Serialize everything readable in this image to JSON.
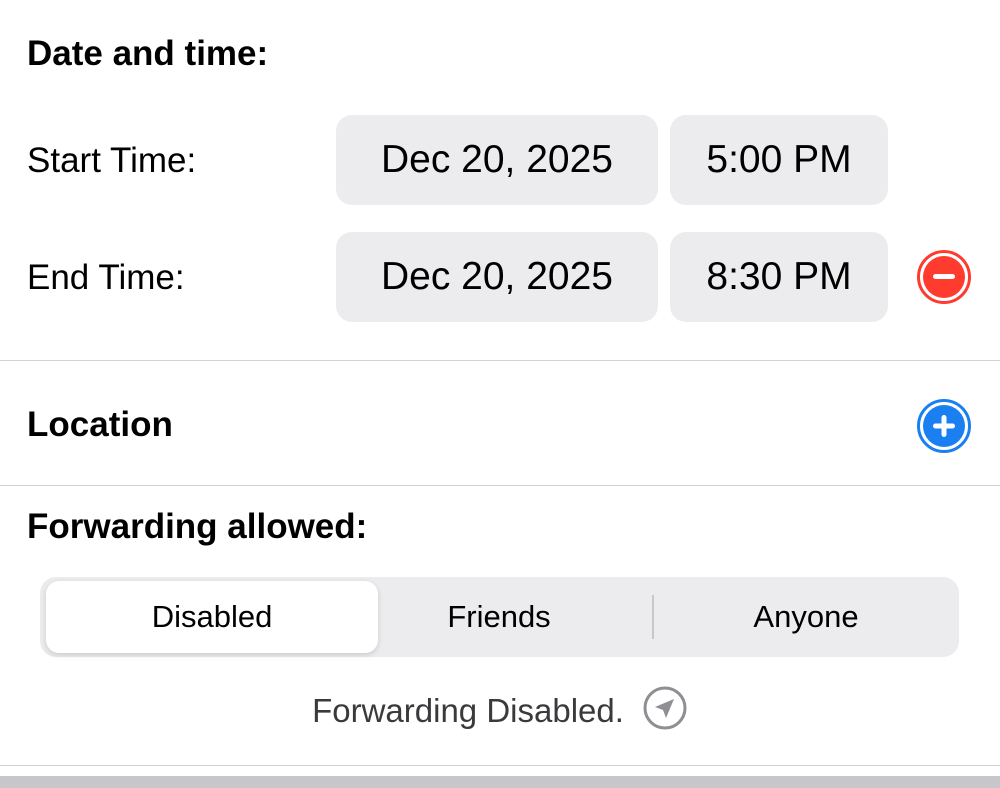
{
  "date_time": {
    "title": "Date and time:",
    "start": {
      "label": "Start Time:",
      "date": "Dec 20, 2025",
      "time": "5:00 PM"
    },
    "end": {
      "label": "End Time:",
      "date": "Dec 20, 2025",
      "time": "8:30 PM"
    },
    "remove_icon": "minus-circle-icon"
  },
  "location": {
    "title": "Location",
    "add_icon": "plus-circle-icon"
  },
  "forwarding": {
    "title": "Forwarding allowed:",
    "options": [
      "Disabled",
      "Friends",
      "Anyone"
    ],
    "selected": "Disabled",
    "status": "Forwarding Disabled.",
    "status_icon": "location-arrow-icon"
  },
  "colors": {
    "remove": "#ff3b30",
    "add": "#1a7ff0",
    "pill_bg": "#ececee"
  }
}
